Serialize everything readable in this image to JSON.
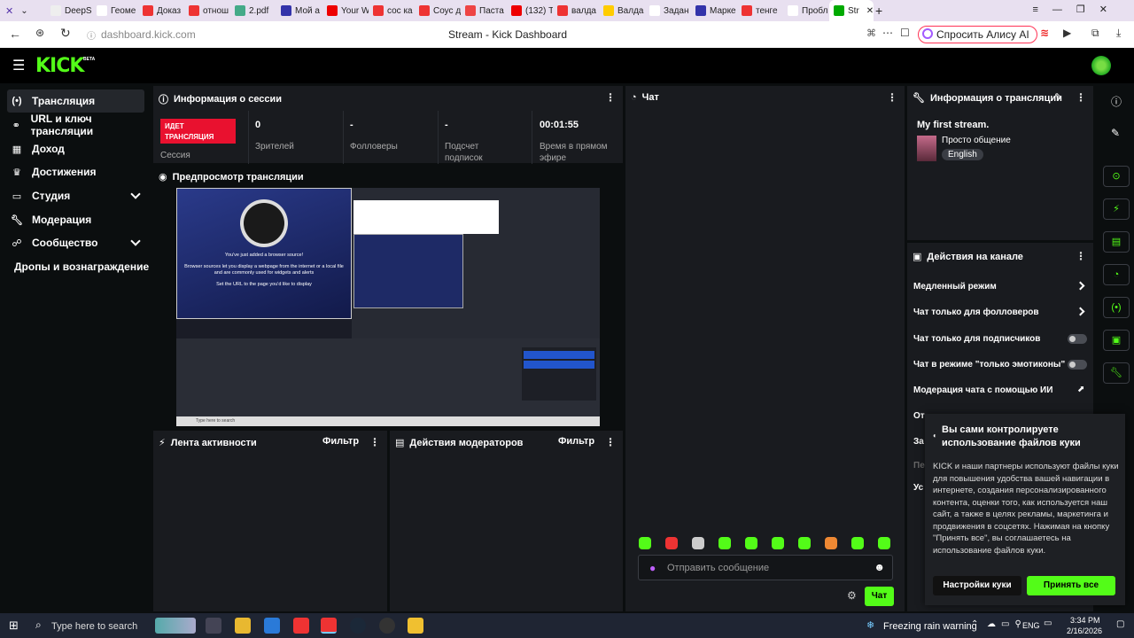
{
  "browser": {
    "tabs": [
      "DeepS",
      "Геоме",
      "Доказ",
      "отнош",
      "2.pdf",
      "Мой а",
      "Your W",
      "сос ка",
      "Соус д",
      "Паста",
      "(132) Т",
      "валда",
      "Валда",
      "Задан",
      "Марке",
      "тенге",
      "Пробл",
      "Str"
    ],
    "url": "dashboard.kick.com",
    "title": "Stream - Kick Dashboard",
    "alice": "Спросить Алису AI"
  },
  "brand": {
    "logo": "KICK",
    "beta": "BETA",
    "accent": "#53fc18"
  },
  "sidebar": {
    "items": [
      {
        "label": "Трансляция",
        "icon": "broadcast-icon"
      },
      {
        "label": "URL и ключ трансляции",
        "icon": "link-icon"
      },
      {
        "label": "Доход",
        "icon": "income-icon"
      },
      {
        "label": "Достижения",
        "icon": "trophy-icon"
      },
      {
        "label": "Студия",
        "icon": "studio-icon"
      },
      {
        "label": "Модерация",
        "icon": "wrench-icon"
      },
      {
        "label": "Сообщество",
        "icon": "people-icon"
      },
      {
        "label": "Дропы и вознаграждение",
        "icon": ""
      }
    ]
  },
  "session": {
    "title": "Информация о сессии",
    "live_badge": "ИДЕТ ТРАНСЛЯЦИЯ",
    "session_label": "Сессия",
    "stats": [
      {
        "value": "0",
        "label": "Зрителей"
      },
      {
        "value": "-",
        "label": "Фолловеры"
      },
      {
        "value": "-",
        "label": "Подсчет подписок"
      },
      {
        "value": "00:01:55",
        "label": "Время в прямом эфире"
      }
    ]
  },
  "preview": {
    "title": "Предпросмотр трансляции",
    "obs_heading": "You've just added a browser source!",
    "obs_body": "Browser sources let you display a webpage from the internet or a local file and are commonly used for widgets and alerts",
    "obs_hint": "Set the URL to the page you'd like to display",
    "win_search": "Type here to search",
    "obs_buttons": [
      "Stop Streaming",
      "Stop Recording",
      "Start Virtual Camera",
      "Studio Mode",
      "Settings"
    ]
  },
  "activity": {
    "title": "Лента активности",
    "filter": "Фильтр"
  },
  "mod_actions": {
    "title": "Действия модераторов",
    "filter": "Фильтр"
  },
  "chat": {
    "title": "Чат",
    "placeholder": "Отправить сообщение",
    "send": "Чат"
  },
  "stream_info": {
    "title": "Информация о трансляции",
    "stream_title": "My first stream.",
    "category": "Просто общение",
    "language": "English"
  },
  "channel_actions": {
    "title": "Действия на канале",
    "rows": [
      {
        "label": "Медленный режим"
      },
      {
        "label": "Чат только для фолловеров"
      },
      {
        "label": "Чат только для подписчиков"
      },
      {
        "label": "Чат в режиме \"только эмотиконы\""
      },
      {
        "label": "Модерация чата с помощью ИИ"
      },
      {
        "label": "От"
      },
      {
        "label": "За"
      },
      {
        "label": "Пе"
      },
      {
        "label": "Ус"
      }
    ]
  },
  "cookie": {
    "title": "Вы сами контролируете использование файлов куки",
    "body": "KICK и наши партнеры используют файлы куки для повышения удобства вашей навигации в интернете, создания персонализированного контента, оценки того, как используется наш сайт, а также в целях рекламы, маркетинга и продвижения в соцсетях. Нажимая на кнопку \"Принять все\", вы соглашаетесь на использование файлов куки.",
    "settings": "Настройки куки",
    "accept": "Принять все"
  },
  "taskbar": {
    "search": "Type here to search",
    "weather": "Freezing rain warning",
    "lang": "ENG",
    "time": "3:34 PM",
    "date": "2/16/2026"
  }
}
